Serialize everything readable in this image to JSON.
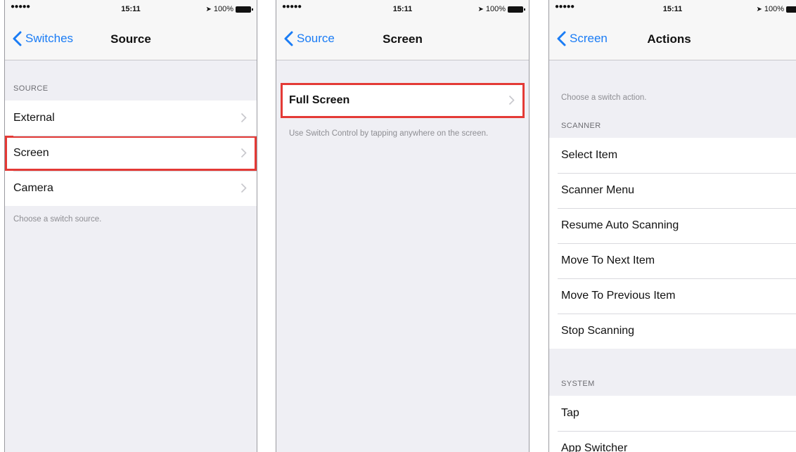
{
  "status_bar": {
    "signal": "●●●●●",
    "time": "15:11",
    "battery": "100%"
  },
  "colors": {
    "accent": "#1a7cf5",
    "highlight": "#e43a36",
    "background": "#efeff4"
  },
  "panel_source": {
    "back_label": "Switches",
    "title": "Source",
    "section_header": "SOURCE",
    "items": [
      {
        "label": "External"
      },
      {
        "label": "Screen",
        "highlighted": true
      },
      {
        "label": "Camera"
      }
    ],
    "footer": "Choose a switch source."
  },
  "panel_screen": {
    "back_label": "Source",
    "title": "Screen",
    "items": [
      {
        "label": "Full Screen",
        "highlighted": true
      }
    ],
    "footer": "Use Switch Control by tapping anywhere on the screen."
  },
  "panel_actions": {
    "back_label": "Screen",
    "title": "Actions",
    "intro": "Choose a switch action.",
    "scanner_header": "SCANNER",
    "scanner_items": [
      {
        "label": "Select Item"
      },
      {
        "label": "Scanner Menu"
      },
      {
        "label": "Resume Auto Scanning"
      },
      {
        "label": "Move To Next Item"
      },
      {
        "label": "Move To Previous Item"
      },
      {
        "label": "Stop Scanning"
      }
    ],
    "system_header": "SYSTEM",
    "system_items": [
      {
        "label": "Tap"
      },
      {
        "label": "App Switcher"
      }
    ]
  }
}
